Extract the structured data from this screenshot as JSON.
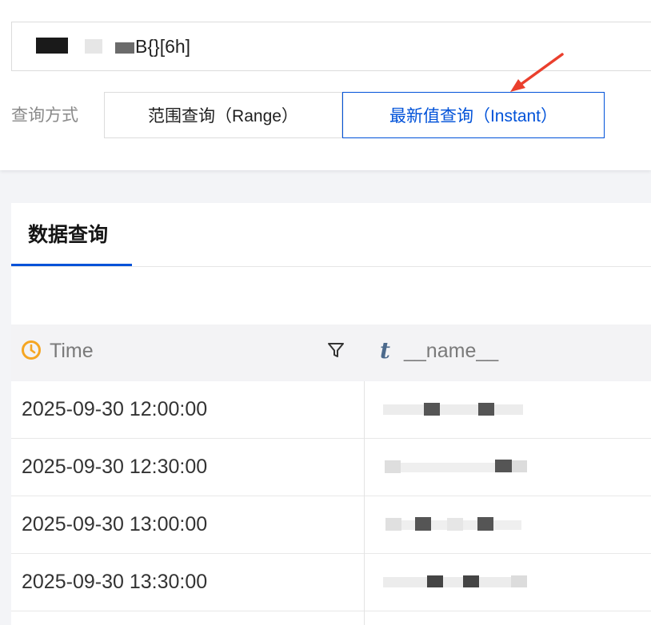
{
  "query_input": {
    "visible_text": "B{}[6h]"
  },
  "query_mode": {
    "label": "查询方式",
    "options": [
      {
        "label": "范围查询（Range）",
        "selected": false
      },
      {
        "label": "最新值查询（Instant）",
        "selected": true
      }
    ]
  },
  "tabs": [
    {
      "label": "数据查询",
      "active": true
    }
  ],
  "table": {
    "columns": [
      {
        "label": "Time",
        "icon": "clock-icon",
        "filter_icon": "filter-icon"
      },
      {
        "label": "__name__",
        "type_glyph": "t"
      }
    ],
    "rows": [
      {
        "time": "2025-09-30 12:00:00"
      },
      {
        "time": "2025-09-30 12:30:00"
      },
      {
        "time": "2025-09-30 13:00:00"
      },
      {
        "time": "2025-09-30 13:30:00"
      }
    ]
  },
  "colors": {
    "accent": "#0052d9",
    "annotation_arrow": "#ea3f2d",
    "clock_icon": "#f5a623",
    "page_background": "#f3f4f7"
  }
}
